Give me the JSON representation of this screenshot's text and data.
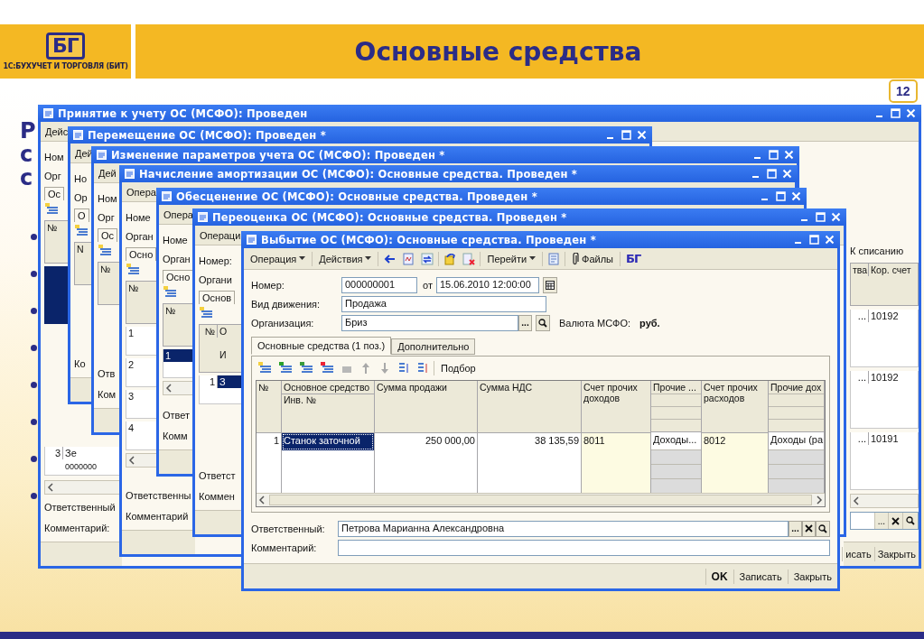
{
  "header": {
    "logo_mark": "БГ",
    "logo_caption": "1С:БУХУЧЕТ И ТОРГОВЛЯ (БИТ)",
    "title": "Основные средства",
    "page_number": "12"
  },
  "slide_fragments": [
    "Р",
    "с",
    "с"
  ],
  "background_windows": [
    {
      "title": "Принятие к учету ОС (МСФО): Проведен",
      "menu": "Дейс",
      "strip": [
        {
          "kind": "label",
          "texts": [
            "Ном"
          ]
        },
        {
          "kind": "label",
          "texts": [
            "Орг"
          ]
        },
        {
          "kind": "tab",
          "texts": [
            "Ос"
          ]
        },
        {
          "kind": "tool"
        },
        {
          "kind": "header",
          "texts": [
            "№"
          ]
        },
        {
          "kind": "row",
          "selected": true
        }
      ],
      "footer": [
        {
          "kind": "row",
          "texts": [
            "3",
            "Зе"
          ],
          "sub": "0000000",
          "selected": false
        },
        {
          "kind": "scroll"
        },
        {
          "kind": "label",
          "texts": [
            "Ответственный"
          ]
        },
        {
          "kind": "label",
          "texts": [
            "Комментарий:"
          ]
        }
      ],
      "right": [
        {
          "kind": "label",
          "texts": [
            "К списанию"
          ]
        },
        {
          "kind": "header",
          "texts": [
            "тва",
            "Кор. счет"
          ]
        },
        {
          "kind": "row",
          "texts": [
            "...",
            "10192"
          ],
          "selected": false
        },
        {
          "kind": "row",
          "texts": [
            "...",
            "10192"
          ],
          "selected": false
        },
        {
          "kind": "row",
          "texts": [
            "...",
            "10191"
          ],
          "selected": false
        },
        {
          "kind": "scroll"
        },
        {
          "kind": "field",
          "texts": [
            "..."
          ]
        }
      ],
      "buttons": [
        "исать",
        "Закрыть"
      ]
    },
    {
      "title": "Перемещение ОС (МСФО): Проведен *",
      "menu": "Дей",
      "strip": [
        {
          "kind": "label",
          "texts": [
            "Но"
          ]
        },
        {
          "kind": "label",
          "texts": [
            "Ор"
          ]
        },
        {
          "kind": "tab",
          "texts": [
            "О"
          ]
        },
        {
          "kind": "tool"
        },
        {
          "kind": "header",
          "texts": [
            "N"
          ]
        }
      ],
      "footer": [
        {
          "kind": "label",
          "texts": [
            "Ко"
          ]
        }
      ]
    },
    {
      "title": "Изменение параметров учета ОС (МСФО): Проведен *",
      "menu": "Дей",
      "strip": [
        {
          "kind": "label",
          "texts": [
            "Ном"
          ]
        },
        {
          "kind": "label",
          "texts": [
            "Орг"
          ]
        },
        {
          "kind": "tab",
          "texts": [
            "Ос"
          ]
        },
        {
          "kind": "tool"
        },
        {
          "kind": "header",
          "texts": [
            "№"
          ]
        }
      ],
      "footer": [
        {
          "kind": "label",
          "texts": [
            "Отв"
          ]
        },
        {
          "kind": "label",
          "texts": [
            "Ком"
          ]
        }
      ]
    },
    {
      "title": "Начисление амортизации ОС (МСФО): Основные средства. Проведен *",
      "menu": "Опера",
      "strip": [
        {
          "kind": "label",
          "texts": [
            "Номе"
          ]
        },
        {
          "kind": "label",
          "texts": [
            "Орган"
          ]
        },
        {
          "kind": "tab",
          "texts": [
            "Осно"
          ]
        },
        {
          "kind": "tool"
        },
        {
          "kind": "header",
          "texts": [
            "№"
          ]
        },
        {
          "kind": "row",
          "texts": [
            "1"
          ],
          "selected": false
        },
        {
          "kind": "row",
          "texts": [
            "2"
          ],
          "selected": false
        },
        {
          "kind": "row",
          "texts": [
            "3"
          ],
          "selected": false
        },
        {
          "kind": "row",
          "texts": [
            "4"
          ],
          "selected": false
        },
        {
          "kind": "scroll"
        }
      ],
      "footer": [
        {
          "kind": "label",
          "texts": [
            "Ответственны"
          ]
        },
        {
          "kind": "label",
          "texts": [
            "Комментарий"
          ]
        }
      ]
    },
    {
      "title": "Обесценение ОС (МСФО): Основные средства. Проведен *",
      "menu": "Опера",
      "strip": [
        {
          "kind": "label",
          "texts": [
            "Номе"
          ]
        },
        {
          "kind": "label",
          "texts": [
            "Орган"
          ]
        },
        {
          "kind": "tab",
          "texts": [
            "Осно"
          ]
        },
        {
          "kind": "tool"
        },
        {
          "kind": "header",
          "texts": [
            "№"
          ]
        },
        {
          "kind": "row",
          "texts": [
            "1"
          ],
          "selected": true
        },
        {
          "kind": "scroll"
        }
      ],
      "footer": [
        {
          "kind": "label",
          "texts": [
            "Ответ"
          ]
        },
        {
          "kind": "label",
          "texts": [
            "Комм"
          ]
        }
      ]
    },
    {
      "title": "Переоценка ОС (МСФО): Основные средства. Проведен *",
      "menu": "Операци",
      "strip": [
        {
          "kind": "label",
          "texts": [
            "Номер:"
          ]
        },
        {
          "kind": "label",
          "texts": [
            "Органи"
          ]
        },
        {
          "kind": "tab",
          "texts": [
            "Основ"
          ]
        },
        {
          "kind": "tool"
        },
        {
          "kind": "header",
          "texts": [
            "№",
            "О"
          ],
          "sub": "И"
        },
        {
          "kind": "row",
          "texts": [
            "1",
            "З"
          ],
          "selected": true
        }
      ],
      "footer": [
        {
          "kind": "label",
          "texts": [
            "Ответст"
          ]
        },
        {
          "kind": "label",
          "texts": [
            "Коммен"
          ]
        }
      ]
    }
  ],
  "front_window": {
    "title": "Выбытие ОС (МСФО): Основные средства. Проведен *",
    "toolbar": {
      "operation": "Операция",
      "actions": "Действия",
      "goto": "Перейти",
      "files": "Файлы",
      "logo": "БГ"
    },
    "number_label": "Номер:",
    "number": "000000001",
    "date_label": "от",
    "date": "15.06.2010 12:00:00",
    "movement_label": "Вид движения:",
    "movement": "Продажа",
    "org_label": "Организация:",
    "org": "Бриз",
    "org_select": "...",
    "currency_label": "Валюта МСФО:",
    "currency": "руб.",
    "tabs": [
      {
        "label": "Основные средства (1 поз.)",
        "selected": true
      },
      {
        "label": "Дополнительно",
        "selected": false
      }
    ],
    "pick_button": "Подбор",
    "table": {
      "columns": [
        {
          "label": "№",
          "kind": "number"
        },
        {
          "label": "Основное средство",
          "sublabel": "Инв. №",
          "kind": "text"
        },
        {
          "label": "Сумма продажи",
          "kind": "money"
        },
        {
          "label": "Сумма НДС",
          "kind": "money"
        },
        {
          "label": "Счет прочих доходов",
          "kind": "account"
        },
        {
          "label": "Прочие ...",
          "kind": "split"
        },
        {
          "label": "Счет прочих расходов",
          "kind": "account"
        },
        {
          "label": "Прочие дох",
          "kind": "split"
        }
      ],
      "rows": [
        {
          "cells": [
            "1",
            "Станок заточной",
            "250 000,00",
            "38 135,59",
            "8011",
            "Доходы...",
            "8012",
            "Доходы (ра"
          ],
          "selected": true
        }
      ]
    },
    "responsible_label": "Ответственный:",
    "responsible": "Петрова Марианна Александровна",
    "responsible_select": "...",
    "comment_label": "Комментарий:",
    "buttons": [
      {
        "label": "OK",
        "default": true
      },
      {
        "label": "Записать",
        "default": false
      },
      {
        "label": "Закрыть",
        "default": false
      }
    ]
  }
}
